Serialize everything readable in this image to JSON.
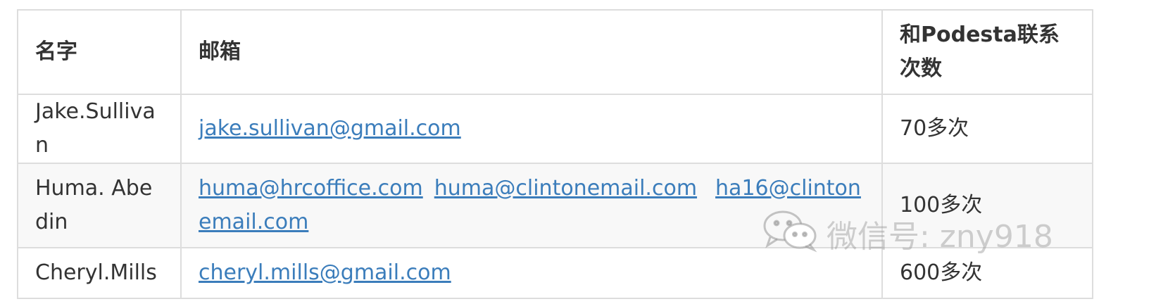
{
  "table": {
    "headers": [
      "名字",
      "邮箱",
      "和Podesta联系次数"
    ],
    "rows": [
      {
        "name": "Jake.Sullivan",
        "emails": [
          "jake.sullivan@gmail.com"
        ],
        "count": "70多次"
      },
      {
        "name": "Huma. Abedin",
        "emails": [
          "huma@hrcoffice.com",
          "huma@clintonemail.com",
          "ha16@clintonemail.com"
        ],
        "count": "100多次"
      },
      {
        "name": "Cheryl.Mills",
        "emails": [
          "cheryl.mills@gmail.com"
        ],
        "count": "600多次"
      }
    ]
  },
  "watermark": {
    "text": "微信号: zny918",
    "icon": "wechat-icon"
  },
  "colors": {
    "link": "#3b7dbb",
    "border": "#dddddd",
    "stripe": "#f8f8f8",
    "text": "#333333"
  }
}
